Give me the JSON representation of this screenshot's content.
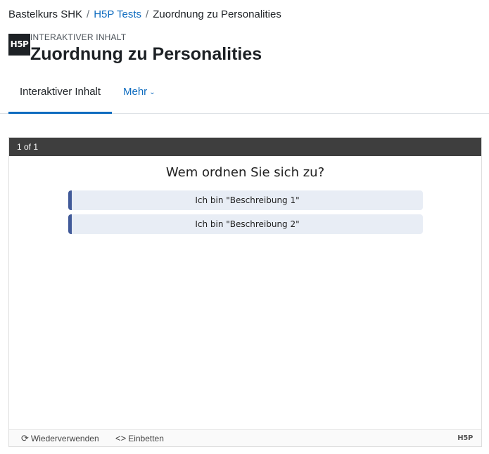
{
  "breadcrumb": {
    "items": [
      {
        "label": "Bastelkurs SHK"
      },
      {
        "label": "H5P Tests"
      },
      {
        "label": "Zuordnung zu Personalities"
      }
    ],
    "separator": "/"
  },
  "header": {
    "logo_text": "H5P",
    "pre_title": "Interaktiver Inhalt",
    "title": "Zuordnung zu Personalities"
  },
  "tabs": {
    "active_label": "Interaktiver Inhalt",
    "more_label": "Mehr",
    "more_icon": "chevron-down-icon"
  },
  "h5p": {
    "progress": "1 of 1",
    "question": "Wem ordnen Sie sich zu?",
    "answers": [
      {
        "label": "Ich bin \"Beschreibung 1\""
      },
      {
        "label": "Ich bin \"Beschreibung 2\""
      }
    ],
    "footer": {
      "reuse_label": "Wiederverwenden",
      "reuse_icon": "refresh-icon",
      "embed_label": "Einbetten",
      "embed_icon": "code-icon",
      "logo_text": "H5P"
    }
  },
  "colors": {
    "link": "#0f6cbf",
    "h5p_topbar": "#3e3e3e",
    "answer_bg": "#e8edf5",
    "answer_accent": "#415a99"
  }
}
